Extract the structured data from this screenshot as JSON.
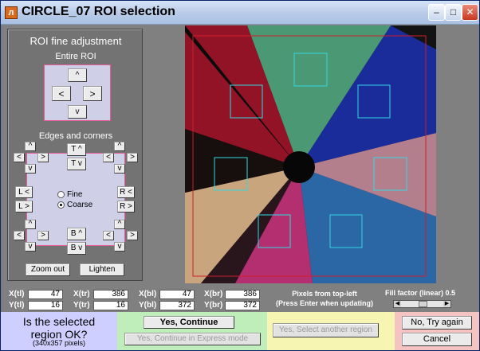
{
  "window": {
    "title": "CIRCLE_07 ROI selection",
    "icon": "matlab-icon",
    "controls": [
      "minimize-icon",
      "maximize-icon",
      "close-icon"
    ]
  },
  "panel": {
    "title": "ROI fine adjustment",
    "entire_roi_label": "Entire ROI",
    "entire_roi_buttons": {
      "up": "^",
      "left": "<",
      "right": ">",
      "down": "v"
    },
    "edges_label": "Edges and corners",
    "top_edge": {
      "up": "T ^",
      "down": "T v"
    },
    "bottom_edge": {
      "up": "B ^",
      "down": "B v"
    },
    "left_edge": {
      "left": "L <",
      "right": "L >"
    },
    "right_edge": {
      "left": "R <",
      "right": "R >"
    },
    "corner_arrows": {
      "up": "^",
      "down": "v",
      "left": "<",
      "right": ">"
    },
    "mode_options": [
      {
        "label": "Fine",
        "selected": false
      },
      {
        "label": "Coarse",
        "selected": true
      }
    ],
    "zoom_out": "Zoom out",
    "lighten": "Lighten"
  },
  "coords": {
    "row1": [
      {
        "label": "X(tl)",
        "value": "47"
      },
      {
        "label": "X(tr)",
        "value": "386"
      },
      {
        "label": "X(bl)",
        "value": "47"
      },
      {
        "label": "X(br)",
        "value": "386"
      }
    ],
    "row2": [
      {
        "label": "Y(tl)",
        "value": "16"
      },
      {
        "label": "Y(tr)",
        "value": "16"
      },
      {
        "label": "Y(bl)",
        "value": "372"
      },
      {
        "label": "Y(br)",
        "value": "372"
      }
    ],
    "info_line1": "Pixels from top-left",
    "info_line2": "(Press Enter when updating)",
    "fill_factor_label": "Fill factor (linear) 0.5",
    "fill_factor": 0.5
  },
  "bottom": {
    "question_line1": "Is the selected",
    "question_line2": "region OK?",
    "question_sub": "(340x357 pixels)",
    "yes_continue": "Yes, Continue",
    "yes_express": "Yes, Continue in Express mode",
    "yes_select_another": "Yes, Select another region",
    "no_try_again": "No, Try again",
    "cancel": "Cancel"
  },
  "colors": {
    "roi_outline": "#d01e2a",
    "patch_outline": "#32d8e0",
    "express_bg": "#bfeebb",
    "question_bg": "#cfcfff",
    "select_bg": "#f6f6b2",
    "no_bg": "#f6c3c3"
  }
}
